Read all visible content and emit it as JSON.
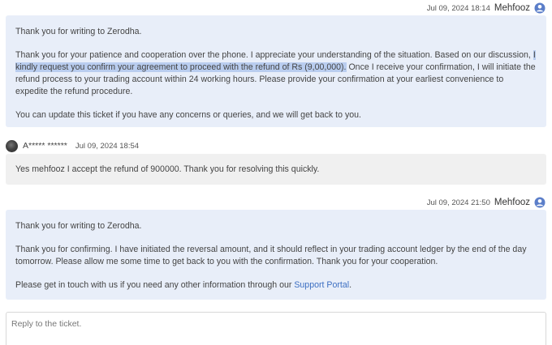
{
  "messages": [
    {
      "author": "Mehfooz",
      "date": "Jul 09, 2024 18:14",
      "greeting": "Thank you for writing to Zerodha.",
      "body_before": "Thank you for your patience and cooperation over the phone. I appreciate your understanding of the situation. Based on our discussion, ",
      "body_highlight": "I kindly request you confirm your agreement to proceed with the refund of Rs (9,00,000).",
      "body_after": " Once I receive your confirmation, I will initiate the refund process to your trading account within 24 working hours. Please provide your confirmation at your earliest convenience to expedite the refund procedure.",
      "footer": "You can update this ticket if you have any concerns or queries, and we will get back to you."
    },
    {
      "author": "A***** ******",
      "date": "Jul 09, 2024 18:54",
      "body": "Yes mehfooz I accept the refund of 900000. Thank you for resolving this quickly."
    },
    {
      "author": "Mehfooz",
      "date": "Jul 09, 2024 21:50",
      "greeting": "Thank you for writing to Zerodha.",
      "body": "Thank you for confirming. I have initiated the reversal amount, and it should reflect in your trading account ledger by the end of the day tomorrow. Please allow me some time to get back to you with the confirmation. Thank you for your cooperation.",
      "footer_before": "Please get in touch with us if you need any other information through our ",
      "footer_link": "Support Portal",
      "footer_after": "."
    }
  ],
  "reply": {
    "placeholder": "Reply to the ticket."
  },
  "colors": {
    "agent_bubble": "#e8eef9",
    "user_bubble": "#f0f0f0",
    "highlight": "#b9cdef",
    "link": "#3d6fc2",
    "avatar_icon": "#5b7ec9"
  },
  "icons": {
    "agent_avatar": "user-circle-icon",
    "user_avatar": "user-photo-avatar"
  }
}
